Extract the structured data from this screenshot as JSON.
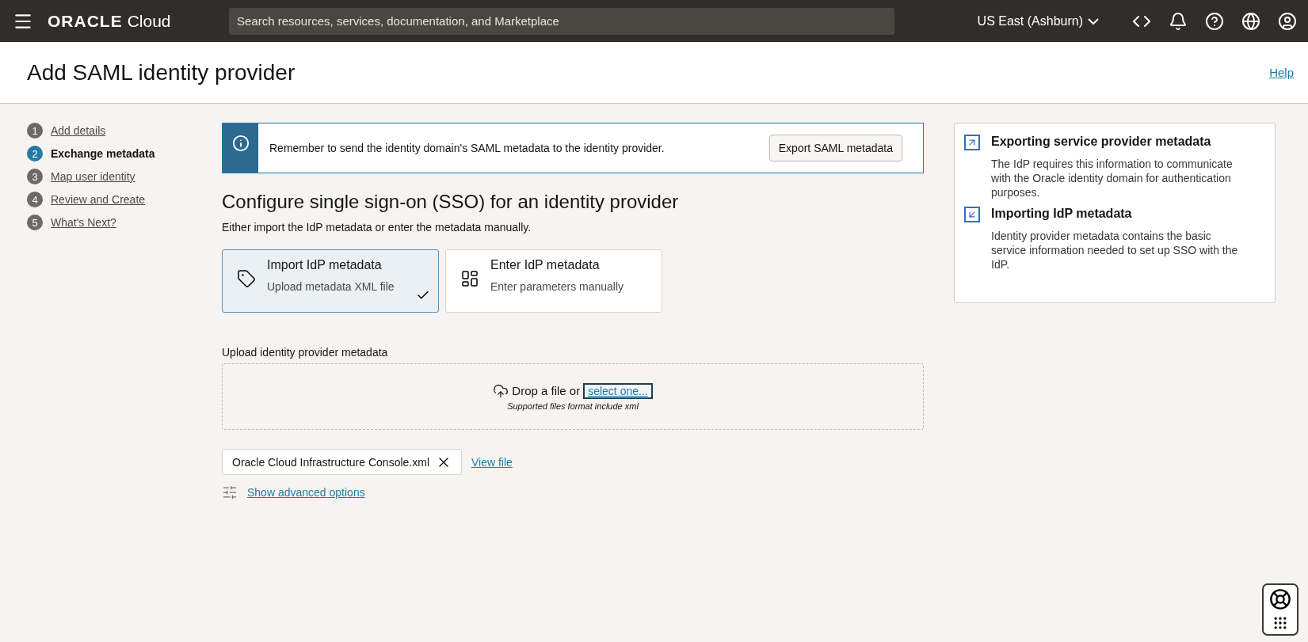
{
  "header": {
    "brand": "ORACLE",
    "product": "Cloud",
    "search": {
      "placeholder": "Search resources, services, documentation, and Marketplace"
    },
    "region": "US East (Ashburn)"
  },
  "page": {
    "title": "Add SAML identity provider",
    "help": "Help"
  },
  "steps": [
    {
      "number": "1",
      "label": "Add details",
      "selected": false
    },
    {
      "number": "2",
      "label": "Exchange metadata",
      "selected": true
    },
    {
      "number": "3",
      "label": "Map user identity",
      "selected": false
    },
    {
      "number": "4",
      "label": "Review and Create",
      "selected": false
    },
    {
      "number": "5",
      "label": "What's Next?",
      "selected": false
    }
  ],
  "banner": {
    "text": "Remember to send the identity domain's SAML metadata to the identity provider.",
    "button": "Export SAML metadata"
  },
  "section": {
    "title": "Configure single sign-on (SSO) for an identity provider",
    "subtitle": "Either import the IdP metadata or enter the metadata manually."
  },
  "options": [
    {
      "kind": "import",
      "title": "Import IdP metadata",
      "description": "Upload metadata XML file",
      "selected": true
    },
    {
      "kind": "enter",
      "title": "Enter IdP metadata",
      "description": "Enter parameters manually",
      "selected": false
    }
  ],
  "upload": {
    "label": "Upload identity provider metadata",
    "drop_text": "Drop a file or",
    "link": "select one...",
    "hint": "Supported files format include xml"
  },
  "file": {
    "name": "Oracle Cloud Infrastructure Console.xml",
    "view": "View file"
  },
  "advanced": "Show advanced options",
  "help_panel": [
    {
      "kind": "export",
      "title": "Exporting service provider metadata",
      "text": "The IdP requires this information to communicate with the Oracle identity domain for authentication purposes."
    },
    {
      "kind": "import",
      "title": "Importing IdP metadata",
      "text": "Identity provider metadata contains the basic service information needed to set up SSO with the IdP."
    }
  ]
}
